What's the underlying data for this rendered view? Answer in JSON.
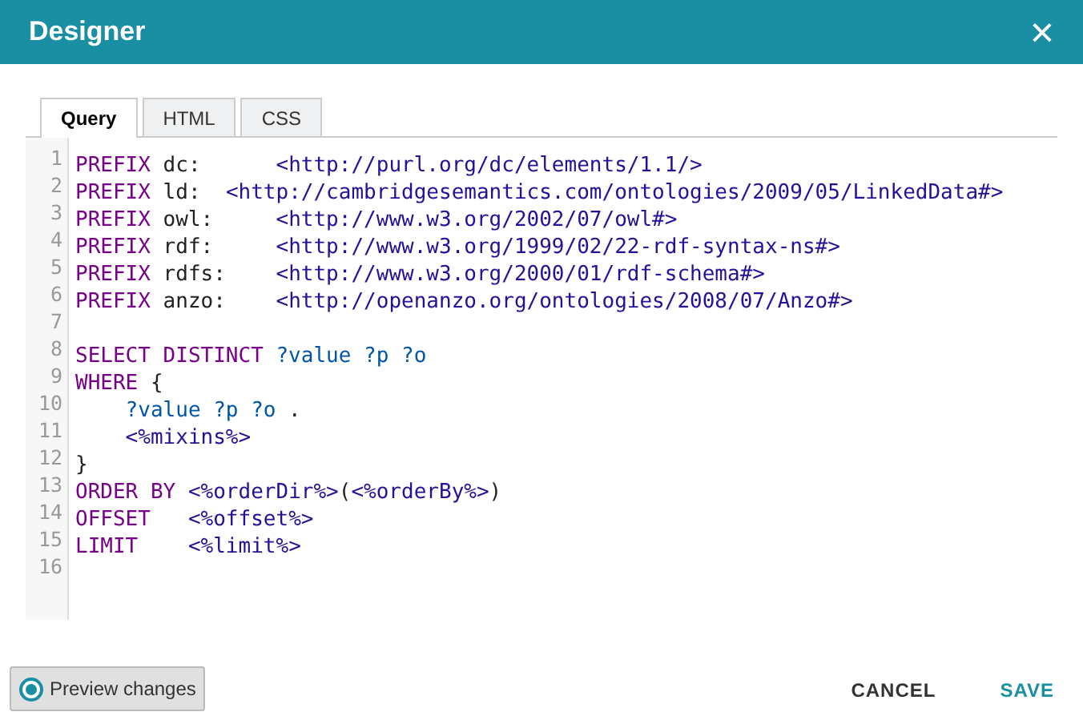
{
  "window": {
    "title": "Designer",
    "close": "×"
  },
  "tabs": [
    {
      "label": "Query",
      "selected": true
    },
    {
      "label": "HTML",
      "selected": false
    },
    {
      "label": "CSS",
      "selected": false
    }
  ],
  "editor": {
    "lines": [
      {
        "number": "1",
        "tokens": [
          {
            "kind": "keyword",
            "text": "PREFIX"
          },
          {
            "kind": "plain",
            "text": " dc:      "
          },
          {
            "kind": "iri",
            "text": "<http://purl.org/dc/elements/1.1/>"
          }
        ]
      },
      {
        "number": "2",
        "tokens": [
          {
            "kind": "keyword",
            "text": "PREFIX"
          },
          {
            "kind": "plain",
            "text": " ld:  "
          },
          {
            "kind": "iri",
            "text": "<http://cambridgesemantics.com/ontologies/2009/05/LinkedData#>"
          }
        ]
      },
      {
        "number": "3",
        "tokens": [
          {
            "kind": "keyword",
            "text": "PREFIX"
          },
          {
            "kind": "plain",
            "text": " owl:     "
          },
          {
            "kind": "iri",
            "text": "<http://www.w3.org/2002/07/owl#>"
          }
        ]
      },
      {
        "number": "4",
        "tokens": [
          {
            "kind": "keyword",
            "text": "PREFIX"
          },
          {
            "kind": "plain",
            "text": " rdf:     "
          },
          {
            "kind": "iri",
            "text": "<http://www.w3.org/1999/02/22-rdf-syntax-ns#>"
          }
        ]
      },
      {
        "number": "5",
        "tokens": [
          {
            "kind": "keyword",
            "text": "PREFIX"
          },
          {
            "kind": "plain",
            "text": " rdfs:    "
          },
          {
            "kind": "iri",
            "text": "<http://www.w3.org/2000/01/rdf-schema#>"
          }
        ]
      },
      {
        "number": "6",
        "tokens": [
          {
            "kind": "keyword",
            "text": "PREFIX"
          },
          {
            "kind": "plain",
            "text": " anzo:    "
          },
          {
            "kind": "iri",
            "text": "<http://openanzo.org/ontologies/2008/07/Anzo#>"
          }
        ]
      },
      {
        "number": "7"
      },
      {
        "number": "8",
        "tokens": [
          {
            "kind": "keyword",
            "text": "SELECT DISTINCT "
          },
          {
            "kind": "variable",
            "text": "?value ?p ?o"
          }
        ]
      },
      {
        "number": "9",
        "tokens": [
          {
            "kind": "keyword",
            "text": "WHERE"
          },
          {
            "kind": "plain",
            "text": " {"
          }
        ]
      },
      {
        "number": "10",
        "tokens": [
          {
            "kind": "variable",
            "text": "    ?value ?p ?o"
          },
          {
            "kind": "plain",
            "text": " ."
          }
        ]
      },
      {
        "number": "11",
        "tokens": [
          {
            "kind": "iri",
            "text": "    <%mixins%>"
          }
        ]
      },
      {
        "number": "12",
        "tokens": [
          {
            "kind": "plain",
            "text": "}"
          }
        ]
      },
      {
        "number": "13",
        "tokens": [
          {
            "kind": "keyword",
            "text": "ORDER BY "
          },
          {
            "kind": "iri",
            "text": "<%orderDir%>"
          },
          {
            "kind": "plain",
            "text": "("
          },
          {
            "kind": "iri",
            "text": "<%orderBy%>"
          },
          {
            "kind": "plain",
            "text": ")"
          }
        ]
      },
      {
        "number": "14",
        "tokens": [
          {
            "kind": "keyword",
            "text": "OFFSET   "
          },
          {
            "kind": "iri",
            "text": "<%offset%>"
          }
        ]
      },
      {
        "number": "15",
        "tokens": [
          {
            "kind": "keyword",
            "text": "LIMIT    "
          },
          {
            "kind": "iri",
            "text": "<%limit%>"
          }
        ]
      },
      {
        "number": "16"
      }
    ]
  },
  "preview": {
    "label": "Preview changes",
    "checked": true
  },
  "buttons": [
    {
      "label": "CANCEL",
      "kind": "secondary"
    },
    {
      "label": "SAVE",
      "kind": "primary"
    }
  ]
}
